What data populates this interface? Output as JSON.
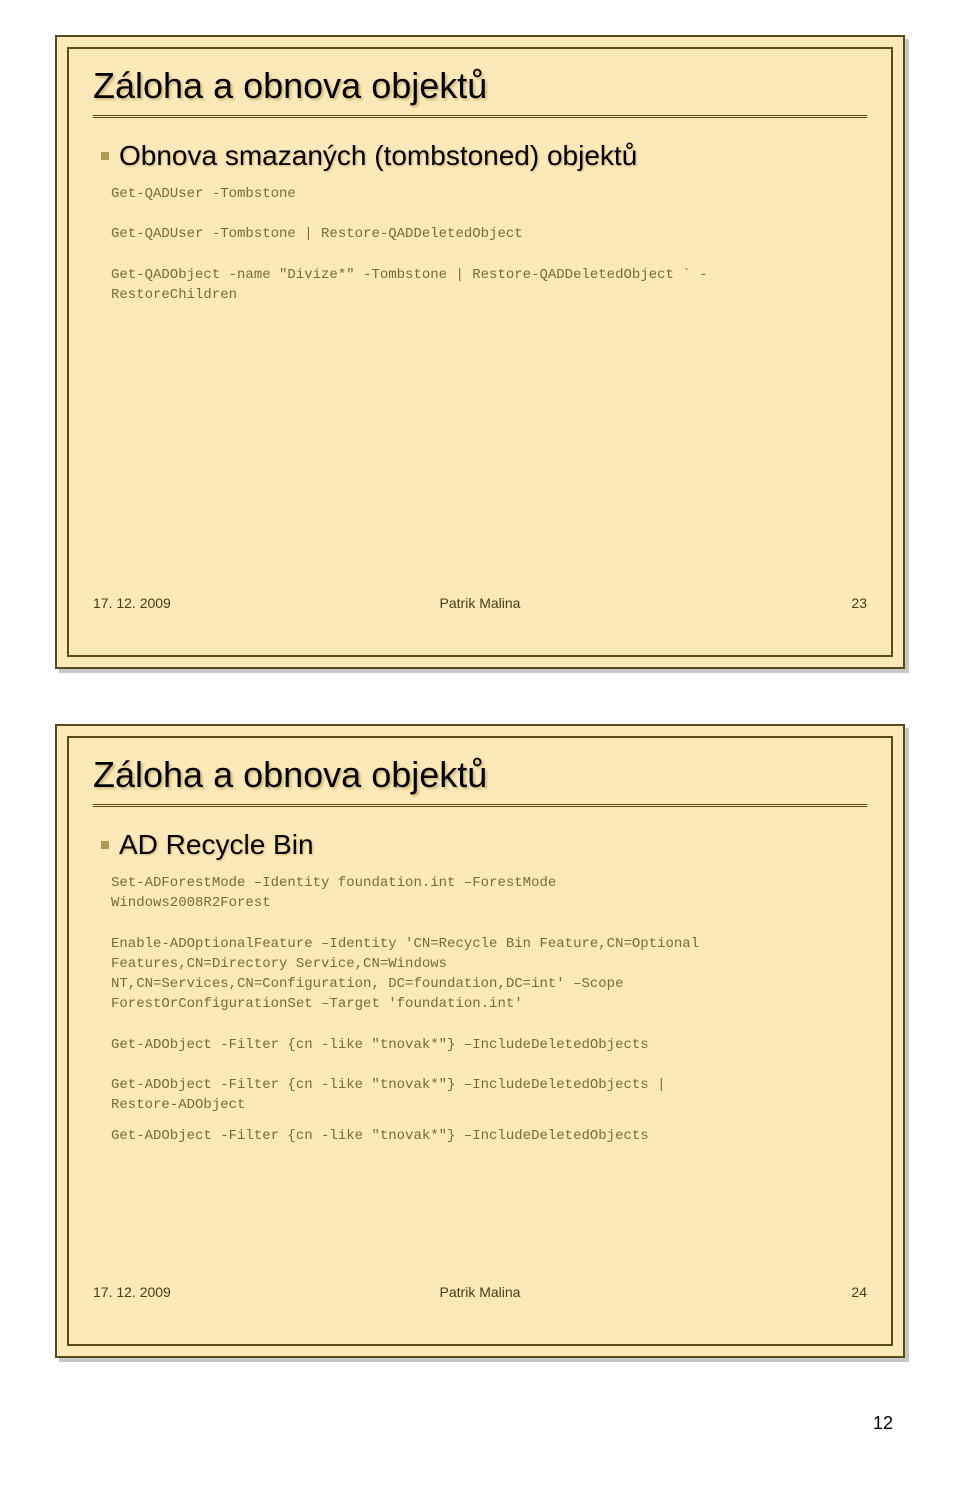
{
  "slide1": {
    "title": "Záloha a obnova objektů",
    "subhead": "Obnova smazaných (tombstoned) objektů",
    "code1": "Get-QADUser -Tombstone",
    "code2": "Get-QADUser -Tombstone | Restore-QADDeletedObject",
    "code3": "Get-QADObject -name \"Divize*\" -Tombstone | Restore-QADDeletedObject ` -\nRestoreChildren",
    "footer_date": "17. 12. 2009",
    "footer_author": "Patrik Malina",
    "footer_page": "23"
  },
  "slide2": {
    "title": "Záloha a obnova objektů",
    "subhead": "AD Recycle Bin",
    "code1": "Set-ADForestMode –Identity foundation.int –ForestMode\nWindows2008R2Forest",
    "code2": "Enable-ADOptionalFeature –Identity 'CN=Recycle Bin Feature,CN=Optional\nFeatures,CN=Directory Service,CN=Windows\nNT,CN=Services,CN=Configuration, DC=foundation,DC=int' –Scope\nForestOrConfigurationSet –Target 'foundation.int'",
    "code3": "Get-ADObject -Filter {cn -like \"tnovak*\"} –IncludeDeletedObjects",
    "code4": "Get-ADObject -Filter {cn -like \"tnovak*\"} –IncludeDeletedObjects |\nRestore-ADObject",
    "code5": "Get-ADObject -Filter {cn -like \"tnovak*\"} –IncludeDeletedObjects",
    "footer_date": "17. 12. 2009",
    "footer_author": "Patrik Malina",
    "footer_page": "24"
  },
  "doc_page": "12"
}
